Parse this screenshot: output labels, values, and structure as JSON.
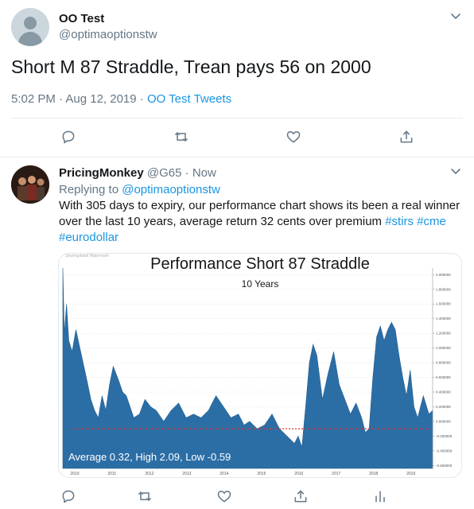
{
  "tweet": {
    "author_name": "OO Test",
    "author_handle": "@optimaoptionstw",
    "text": "Short M 87 Straddle, Trean pays 56 on 2000",
    "time": "5:02 PM · Aug 12, 2019 · ",
    "source": "OO Test Tweets"
  },
  "reply": {
    "author_name": "PricingMonkey",
    "author_handle": "@G65",
    "separator": "·",
    "time": "Now",
    "replying_to_label": "Replying to ",
    "replying_to_handle": "@optimaoptionstw",
    "line1": "With 305 days to expiry, our performance chart shows its been a real winner",
    "line2_text": "over the last 10 years, average return 32 cents over premium ",
    "hashtag1": "#stirs",
    "hashtag2": "#cme",
    "hashtag3": "#eurodollar"
  },
  "chart_data": {
    "type": "area",
    "title": "Performance Short 87 Straddle",
    "subtitle": "10 Years",
    "watermark": "Sharingdetail    Watermark",
    "annotation": "Average 0.32, High 2.09, Low -0.59",
    "x_ticks": [
      "2010",
      "2011",
      "2012",
      "2013",
      "2014",
      "2015",
      "2016",
      "2017",
      "2018",
      "2019"
    ],
    "y_ticks": [
      "2.000000",
      "1.800000",
      "1.600000",
      "1.400000",
      "1.200000",
      "1.000000",
      "0.800000",
      "0.600000",
      "0.400000",
      "0.200000",
      "0.000000",
      "-0.200000",
      "-0.400000",
      "-0.600000"
    ],
    "ylim": [
      -0.64,
      2.09
    ],
    "xlim": [
      2009.8,
      2019.7
    ],
    "reference_line": -0.1,
    "fill_color": "#2b6ea6",
    "reference_color": "#e03030",
    "x": [
      2009.8,
      2009.84,
      2009.9,
      2009.96,
      2010.05,
      2010.15,
      2010.3,
      2010.45,
      2010.55,
      2010.65,
      2010.75,
      2010.85,
      2010.95,
      2011.05,
      2011.15,
      2011.3,
      2011.4,
      2011.5,
      2011.6,
      2011.7,
      2011.85,
      2012.0,
      2012.15,
      2012.3,
      2012.5,
      2012.7,
      2012.9,
      2013.1,
      2013.3,
      2013.5,
      2013.7,
      2013.9,
      2014.1,
      2014.3,
      2014.5,
      2014.65,
      2014.8,
      2015.0,
      2015.2,
      2015.4,
      2015.6,
      2015.8,
      2016.0,
      2016.1,
      2016.2,
      2016.3,
      2016.4,
      2016.5,
      2016.6,
      2016.75,
      2016.9,
      2017.05,
      2017.2,
      2017.35,
      2017.5,
      2017.65,
      2017.8,
      2017.9,
      2018.0,
      2018.1,
      2018.2,
      2018.3,
      2018.4,
      2018.5,
      2018.6,
      2018.7,
      2018.8,
      2018.9,
      2019.0,
      2019.1,
      2019.2,
      2019.3,
      2019.45,
      2019.6,
      2019.7
    ],
    "y": [
      2.09,
      1.2,
      1.6,
      1.1,
      0.95,
      1.25,
      0.9,
      0.55,
      0.3,
      0.15,
      0.05,
      0.35,
      0.15,
      0.5,
      0.75,
      0.55,
      0.4,
      0.35,
      0.2,
      0.05,
      0.1,
      0.3,
      0.2,
      0.15,
      0.0,
      0.15,
      0.25,
      0.05,
      0.1,
      0.05,
      0.15,
      0.35,
      0.2,
      0.05,
      0.1,
      -0.05,
      0.0,
      -0.1,
      -0.05,
      0.1,
      -0.1,
      -0.2,
      -0.3,
      -0.2,
      -0.35,
      0.2,
      0.8,
      1.05,
      0.9,
      0.3,
      0.65,
      0.95,
      0.5,
      0.3,
      0.1,
      0.25,
      0.05,
      -0.15,
      -0.1,
      0.6,
      1.15,
      1.3,
      1.1,
      1.25,
      1.35,
      1.25,
      0.9,
      0.6,
      0.35,
      0.7,
      0.2,
      0.05,
      0.35,
      0.1,
      0.15
    ]
  }
}
